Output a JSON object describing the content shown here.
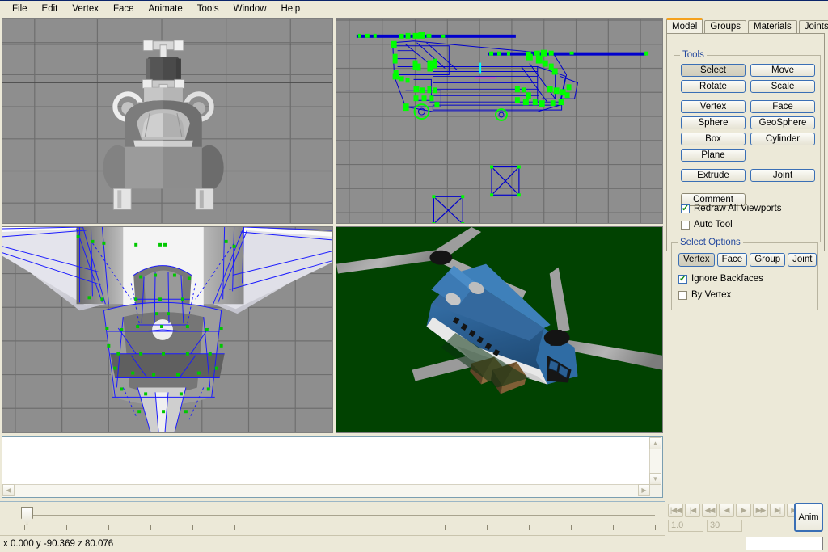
{
  "menu": {
    "items": [
      {
        "label": "File"
      },
      {
        "label": "Edit"
      },
      {
        "label": "Vertex"
      },
      {
        "label": "Face"
      },
      {
        "label": "Animate"
      },
      {
        "label": "Tools"
      },
      {
        "label": "Window"
      },
      {
        "label": "Help"
      }
    ]
  },
  "panel": {
    "tabs": [
      {
        "label": "Model",
        "active": true
      },
      {
        "label": "Groups",
        "active": false
      },
      {
        "label": "Materials",
        "active": false
      },
      {
        "label": "Joints",
        "active": false
      }
    ],
    "tools_group_label": "Tools",
    "tool_buttons": [
      {
        "label": "Select",
        "pressed": true
      },
      {
        "label": "Move",
        "pressed": false
      },
      {
        "label": "Rotate",
        "pressed": false
      },
      {
        "label": "Scale",
        "pressed": false
      },
      {
        "label": "Vertex",
        "pressed": false
      },
      {
        "label": "Face",
        "pressed": false
      },
      {
        "label": "Sphere",
        "pressed": false
      },
      {
        "label": "GeoSphere",
        "pressed": false
      },
      {
        "label": "Box",
        "pressed": false
      },
      {
        "label": "Cylinder",
        "pressed": false
      },
      {
        "label": "Plane",
        "pressed": false
      },
      {
        "label": "Extrude",
        "pressed": false
      },
      {
        "label": "Joint",
        "pressed": false
      }
    ],
    "comment_button": "Comment",
    "checkboxes": [
      {
        "label": "Redraw All Viewports",
        "checked": true
      },
      {
        "label": "Auto Tool",
        "checked": false
      }
    ],
    "select_options_label": "Select Options",
    "select_option_buttons": [
      {
        "label": "Vertex",
        "pressed": true
      },
      {
        "label": "Face",
        "pressed": false
      },
      {
        "label": "Group",
        "pressed": false
      },
      {
        "label": "Joint",
        "pressed": false
      }
    ],
    "select_checkboxes": [
      {
        "label": "Ignore Backfaces",
        "checked": true
      },
      {
        "label": "By Vertex",
        "checked": false
      }
    ]
  },
  "viewports": {
    "top_left": {
      "name": "front-shaded-view",
      "background": "#8e8e8e",
      "mode": "flat-shaded"
    },
    "top_right": {
      "name": "side-wireframe-view",
      "background": "#8e8e8e",
      "mode": "wireframe",
      "edge_color": "#0000cc",
      "vertex_color": "#00ff00"
    },
    "bottom_left": {
      "name": "top-wireframe-shaded-view",
      "background": "#8e8e8e",
      "mode": "shaded-wireframe",
      "edge_color": "#1a1aff",
      "vertex_color": "#00c800"
    },
    "bottom_right": {
      "name": "perspective-textured-view",
      "background": "#014201",
      "mode": "textured",
      "model_color": "#2a5f93"
    }
  },
  "text_panel": {
    "value": "",
    "placeholder": ""
  },
  "animation": {
    "playback_buttons": [
      {
        "name": "rewind-to-start",
        "glyph": "|◀◀"
      },
      {
        "name": "previous-keyframe",
        "glyph": "|◀"
      },
      {
        "name": "skip-back",
        "glyph": "◀◀"
      },
      {
        "name": "step-back",
        "glyph": "◀"
      },
      {
        "name": "step-forward",
        "glyph": "▶"
      },
      {
        "name": "skip-forward",
        "glyph": "▶▶"
      },
      {
        "name": "next-keyframe",
        "glyph": "▶|"
      },
      {
        "name": "forward-to-end",
        "glyph": "▶||"
      }
    ],
    "fps_field": "1.0",
    "frames_field": "30",
    "anim_button": "Anim",
    "timeline_thumb_position": 0,
    "timeline_tick_count": 16
  },
  "status": {
    "coords": "x 0.000 y -90.369 z 80.076"
  },
  "command_field": {
    "value": ""
  }
}
